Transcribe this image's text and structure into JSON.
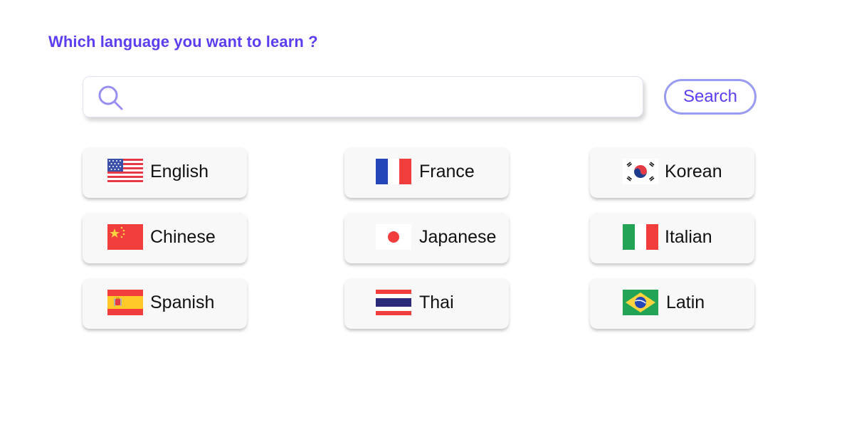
{
  "heading": "Which language you want to learn ?",
  "search": {
    "placeholder": "",
    "value": "",
    "button_label": "Search"
  },
  "colors": {
    "accent": "#5a3ff0",
    "button_border": "#9a9cf2",
    "card_bg": "#f8f8f8"
  },
  "languages": [
    {
      "label": "English",
      "flag": "us-flag-icon"
    },
    {
      "label": "France",
      "flag": "france-flag-icon"
    },
    {
      "label": "Korean",
      "flag": "korea-flag-icon"
    },
    {
      "label": "Chinese",
      "flag": "china-flag-icon"
    },
    {
      "label": "Japanese",
      "flag": "japan-flag-icon"
    },
    {
      "label": "Italian",
      "flag": "italy-flag-icon"
    },
    {
      "label": "Spanish",
      "flag": "spain-flag-icon"
    },
    {
      "label": "Thai",
      "flag": "thailand-flag-icon"
    },
    {
      "label": "Latin",
      "flag": "brazil-flag-icon"
    }
  ]
}
